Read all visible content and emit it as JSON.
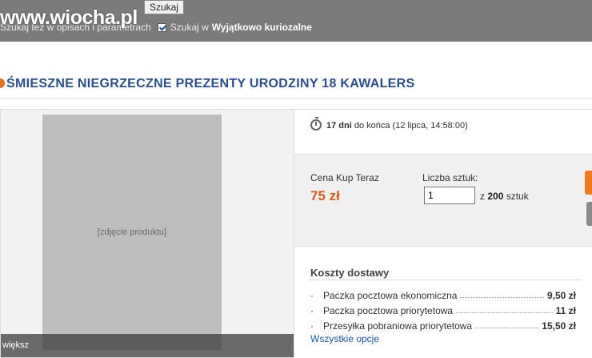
{
  "header": {
    "logo": "www.wiocha.pl",
    "search_button": "Szukaj",
    "checkbox1_label": "Szukaj też w opisach i parametrach",
    "checkbox2_label": "Szukaj w",
    "checkbox2_category": "Wyjątkowo kuriozalne"
  },
  "listing": {
    "title": "ŚMIESZNE NIEGRZECZNE PREZENTY URODZINY 18 KAWALERS",
    "photo_note": "[zdjęcie produktu]",
    "zoom_label": "większ",
    "days_left": "17 dni",
    "time_rest": "do końca (12 lipca, 14:58:00)",
    "price_label": "Cena Kup Teraz",
    "price": "75 zł",
    "qty_label": "Liczba sztuk:",
    "qty_value": "1",
    "qty_prefix": "z",
    "qty_max": "200",
    "qty_unit": "sztuk"
  },
  "shipping": {
    "title": "Koszty dostawy",
    "options": [
      {
        "name": "Paczka pocztowa ekonomiczna",
        "price": "9,50 zł"
      },
      {
        "name": "Paczka pocztowa priorytetowa",
        "price": "11 zł"
      },
      {
        "name": "Przesyłka pobraniowa priorytetowa",
        "price": "15,50 zł"
      }
    ],
    "all_options": "Wszystkie opcje"
  },
  "colors": {
    "accent_orange": "#e05a1e",
    "title_blue": "#2a4f8f",
    "link_blue": "#1a5aa8"
  }
}
